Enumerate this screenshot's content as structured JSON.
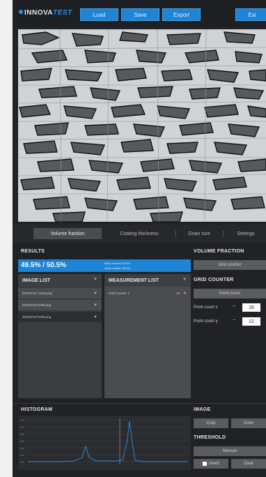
{
  "header": {
    "brand_main": "INNOVA",
    "brand_accent": "TEST",
    "load": "Load",
    "save": "Save",
    "export": "Export",
    "right_button": "Exi"
  },
  "tabs": [
    {
      "label": "Volume fraction"
    },
    {
      "label": "Coating thickness"
    },
    {
      "label": "Grain size"
    },
    {
      "label": "Settings"
    }
  ],
  "results": {
    "title": "RESULTS",
    "ratio": "49.5% / 50.5%",
    "line1": "Black fraction 49.5%",
    "line2": "White fraction 50.5%"
  },
  "image_list": {
    "title": "IMAGE LIST",
    "items": [
      "20230723 f ne08.png",
      "20230723 fne09.png",
      "20230723 fne08.png"
    ]
  },
  "measurement_list": {
    "title": "MEASUREMENT LIST",
    "items": [
      {
        "name": "Grid Counter 1",
        "value": "49"
      }
    ]
  },
  "volume_fraction": {
    "title": "VOLUME FRACTION",
    "button": "Grid counter"
  },
  "grid_counter": {
    "title": "GRID COUNTER",
    "button": "Point count",
    "x_label": "Point count x",
    "x_value": "16",
    "y_label": "Point count y",
    "y_value": "12"
  },
  "histogram": {
    "title": "HISTOGRAM",
    "y_ticks": [
      "1.2",
      "1.0",
      "0.8",
      "0.6",
      "0.4",
      "0.2",
      "0.0"
    ]
  },
  "image_panel": {
    "title": "IMAGE",
    "crop": "Crop",
    "color": "Color"
  },
  "threshold": {
    "title": "THRESHOLD",
    "manual": "Manual",
    "invert": "Invert",
    "clear": "Clear"
  },
  "colors": {
    "accent": "#1d84d6",
    "background": "#202225",
    "panel": "#3a3c40"
  }
}
